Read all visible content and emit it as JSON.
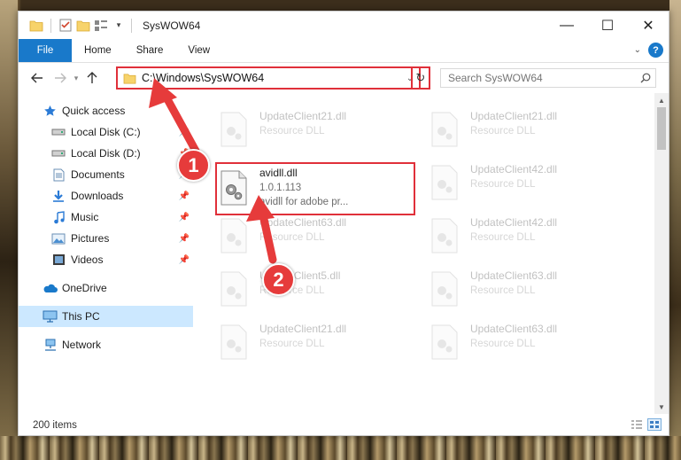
{
  "window": {
    "title": "SysWOW64",
    "controls": {
      "minimize": "—",
      "maximize": "☐",
      "close": "✕"
    }
  },
  "ribbon": {
    "tabs": [
      "File",
      "Home",
      "Share",
      "View"
    ],
    "expand_icon": "chevron-down-icon",
    "help_label": "?"
  },
  "navigation": {
    "address": "C:\\Windows\\SysWOW64",
    "search_placeholder": "Search SysWOW64"
  },
  "sidebar": {
    "items": [
      {
        "label": "Quick access",
        "icon": "star-icon",
        "pinned": false
      },
      {
        "label": "Local Disk (C:)",
        "icon": "drive-icon",
        "pinned": true
      },
      {
        "label": "Local Disk (D:)",
        "icon": "drive-icon",
        "pinned": true
      },
      {
        "label": "Documents",
        "icon": "documents-icon",
        "pinned": true
      },
      {
        "label": "Downloads",
        "icon": "downloads-icon",
        "pinned": true
      },
      {
        "label": "Music",
        "icon": "music-icon",
        "pinned": true
      },
      {
        "label": "Pictures",
        "icon": "pictures-icon",
        "pinned": true
      },
      {
        "label": "Videos",
        "icon": "videos-icon",
        "pinned": true
      },
      {
        "label": "OneDrive",
        "icon": "cloud-icon",
        "pinned": false
      },
      {
        "label": "This PC",
        "icon": "computer-icon",
        "pinned": false,
        "selected": true
      },
      {
        "label": "Network",
        "icon": "network-icon",
        "pinned": false
      }
    ]
  },
  "files": [
    {
      "name": "UpdateClient21.dll",
      "sub": "Resource DLL"
    },
    {
      "name": "UpdateClient21.dll",
      "sub": "Resource DLL"
    },
    {
      "name": "avidll.dll",
      "version": "1.0.1.113",
      "desc": "avidll for adobe pr..."
    },
    {
      "name": "UpdateClient42.dll",
      "sub": "Resource DLL"
    },
    {
      "name": "UpdateClient63.dll",
      "sub": "Resource DLL"
    },
    {
      "name": "UpdateClient42.dll",
      "sub": "Resource DLL"
    },
    {
      "name": "UpdateClient5.dll",
      "sub": "Resource DLL"
    },
    {
      "name": "UpdateClient63.dll",
      "sub": "Resource DLL"
    },
    {
      "name": "UpdateClient21.dll",
      "sub": "Resource DLL"
    },
    {
      "name": "UpdateClient63.dll",
      "sub": "Resource DLL"
    }
  ],
  "status": {
    "item_count": "200 items"
  },
  "callouts": [
    "1",
    "2"
  ],
  "colors": {
    "accent": "#1979ca",
    "callout": "#e63b3b",
    "highlight_border": "#e0303a",
    "selected_nav": "#cce8ff"
  }
}
